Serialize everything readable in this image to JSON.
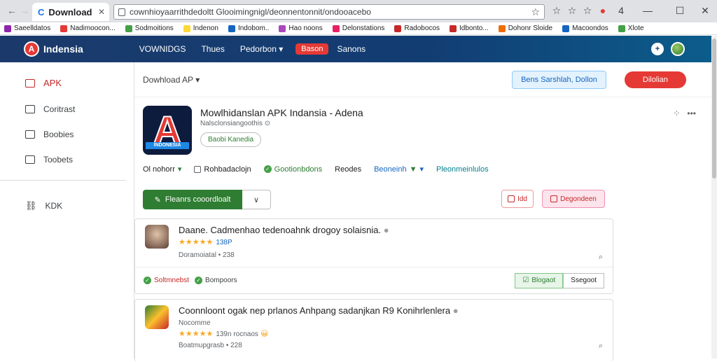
{
  "browser": {
    "tab_title": "Download",
    "url": "cownhioyaarrithdedoltt Glooimingnigl/deonnentonnit/ondooacebo",
    "bookmarks": [
      {
        "label": "Saeelldatos",
        "color": "#8e24aa"
      },
      {
        "label": "Nadimoocon...",
        "color": "#e53935"
      },
      {
        "label": "Sodmoitions",
        "color": "#43a047"
      },
      {
        "label": "Indenon",
        "color": "#fdd835"
      },
      {
        "label": "Indobom..",
        "color": "#1565c0"
      },
      {
        "label": "Hao noons",
        "color": "#ab47bc"
      },
      {
        "label": "Delonstations",
        "color": "#e91e63"
      },
      {
        "label": "Radobocos",
        "color": "#c62828"
      },
      {
        "label": "Idbonto...",
        "color": "#c62828"
      },
      {
        "label": "Dohonr Sloide",
        "color": "#ef6c00"
      },
      {
        "label": "Macoondos",
        "color": "#1565c0"
      },
      {
        "label": "Xlote",
        "color": "#43a047"
      }
    ]
  },
  "site": {
    "brand": "Indensia",
    "logo_letter": "A",
    "nav": [
      "VOWNIDGS",
      "Thues",
      "Pedorbon"
    ],
    "badge": "Bason",
    "nav_tail": "Sanons"
  },
  "sidebar": {
    "items": [
      {
        "label": "APK",
        "icon": "apk-icon"
      },
      {
        "label": "Coritrast",
        "icon": "home-icon"
      },
      {
        "label": "Boobies",
        "icon": "image-icon"
      },
      {
        "label": "Toobets",
        "icon": "list-icon"
      },
      {
        "label": "KDK",
        "icon": "link-icon"
      }
    ]
  },
  "toolbar": {
    "download_select": "Dowhload AP",
    "share_label": "Bens Sarshlah, Dollon",
    "red_label": "Dilolian"
  },
  "app": {
    "title": "Mowlhidanslan APK Indansia - Adena",
    "subtitle": "Nalsclonsiangoothis",
    "chip": "Baobi Kanedia",
    "logo_text": "INDONESIA",
    "meta": [
      {
        "label": "Ol nohorr",
        "style": "plain"
      },
      {
        "label": "Rohbadaclojn",
        "style": "plain"
      },
      {
        "label": "Gootionbdons",
        "style": "green"
      },
      {
        "label": "Reodes",
        "style": "plain"
      },
      {
        "label": "Beoneinh",
        "style": "blue"
      },
      {
        "label": "Pleonmeinlulos",
        "style": "teal"
      }
    ],
    "primary_action": "Fleanrs cooordloalt",
    "small_btn_1": "Idd",
    "small_btn_2": "Degondeen"
  },
  "cards": [
    {
      "title": "Daane. Cadmenhao tedenoahnk drogoy solaisnia.",
      "rating_count": "138P",
      "meta": "Doramoiatal • 238",
      "footer": {
        "status_1": "Soltmnebst",
        "status_2": "Bompoors",
        "btn_ok": "Blogaot",
        "btn_plain": "Ssegoot"
      }
    },
    {
      "title": "Coonnloont ogak nep prlanos Anhpang sadanjkan R9 Konihrlenlera",
      "rating_count": "139n rocnaos",
      "meta": "Boatmupgrasb • 228",
      "emoji": "😀"
    }
  ]
}
